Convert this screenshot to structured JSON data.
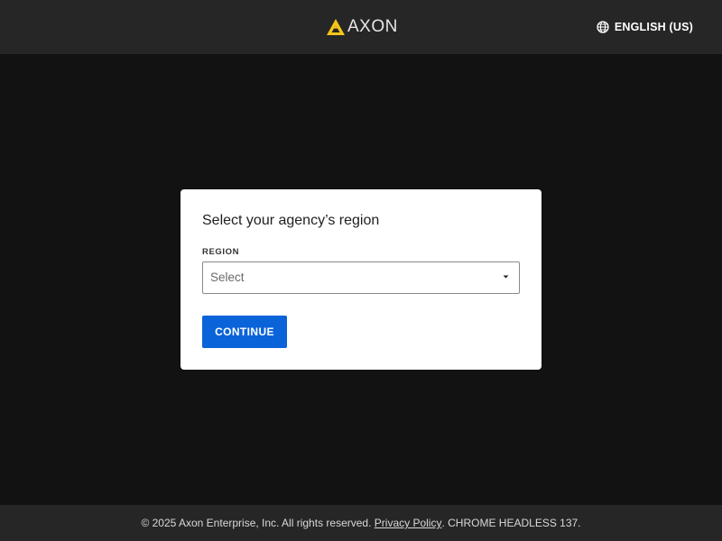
{
  "header": {
    "brand": "AXON",
    "brand_color": "#f5c518",
    "language_icon": "globe-icon",
    "language_label": "ENGLISH (US)"
  },
  "card": {
    "title": "Select your agency’s region",
    "region_label": "REGION",
    "region_select": {
      "value": "Select",
      "icon": "caret-down-icon"
    },
    "continue_label": "CONTINUE",
    "continue_color": "#0b63d9"
  },
  "footer": {
    "copyright": "© 2025 Axon Enterprise, Inc. All rights reserved.",
    "privacy_link": "Privacy Policy",
    "suffix": ". CHROME HEADLESS 137."
  }
}
